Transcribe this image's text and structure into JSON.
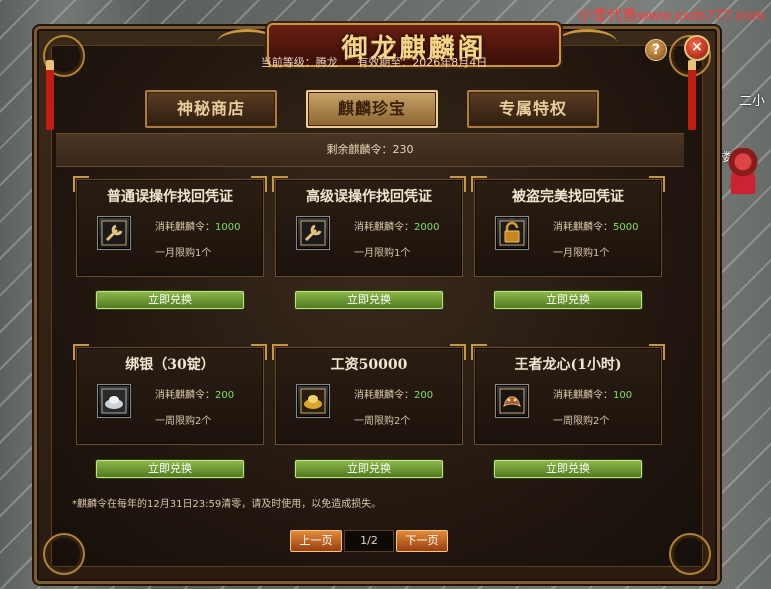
{
  "watermark": "小雪代售www.xxds777.com",
  "scene": {
    "side_label": "二小",
    "side_label2": "楼"
  },
  "window": {
    "title": "御龙麒麟阁"
  },
  "info": {
    "level_label": "当前等级：腾龙",
    "expiry_label": "有效期至：2026年8月4日"
  },
  "tabs": [
    {
      "label": "神秘商店",
      "active": false
    },
    {
      "label": "麒麟珍宝",
      "active": true
    },
    {
      "label": "专属特权",
      "active": false
    }
  ],
  "balance": "剩余麒麟令：230",
  "cards": [
    {
      "title": "普通误操作找回凭证",
      "cost_label": "消耗麒麟令：",
      "cost": "1000",
      "limit": "一月限购1个",
      "icon": "wrench-icon",
      "button": "立即兑换"
    },
    {
      "title": "高级误操作找回凭证",
      "cost_label": "消耗麒麟令：",
      "cost": "2000",
      "limit": "一月限购1个",
      "icon": "wrench-icon",
      "button": "立即兑换"
    },
    {
      "title": "被盗完美找回凭证",
      "cost_label": "消耗麒麟令：",
      "cost": "5000",
      "limit": "一月限购1个",
      "icon": "lock-icon",
      "button": "立即兑换"
    },
    {
      "title": "绑银（30锭）",
      "cost_label": "消耗麒麟令：",
      "cost": "200",
      "limit": "一周限购2个",
      "icon": "silver-ingot-icon",
      "button": "立即兑换"
    },
    {
      "title": "工资50000",
      "cost_label": "消耗麒麟令：",
      "cost": "200",
      "limit": "一周限购2个",
      "icon": "gold-ingot-icon",
      "button": "立即兑换"
    },
    {
      "title": "王者龙心(1小时)",
      "cost_label": "消耗麒麟令：",
      "cost": "100",
      "limit": "一周限购2个",
      "icon": "dragon-heart-icon",
      "button": "立即兑换"
    }
  ],
  "notice": "*麒麟令在每年的12月31日23:59清零，请及时使用，以免造成损失。",
  "pager": {
    "prev": "上一页",
    "page": "1/2",
    "next": "下一页"
  },
  "buttons": {
    "help": "?",
    "close": "×"
  }
}
